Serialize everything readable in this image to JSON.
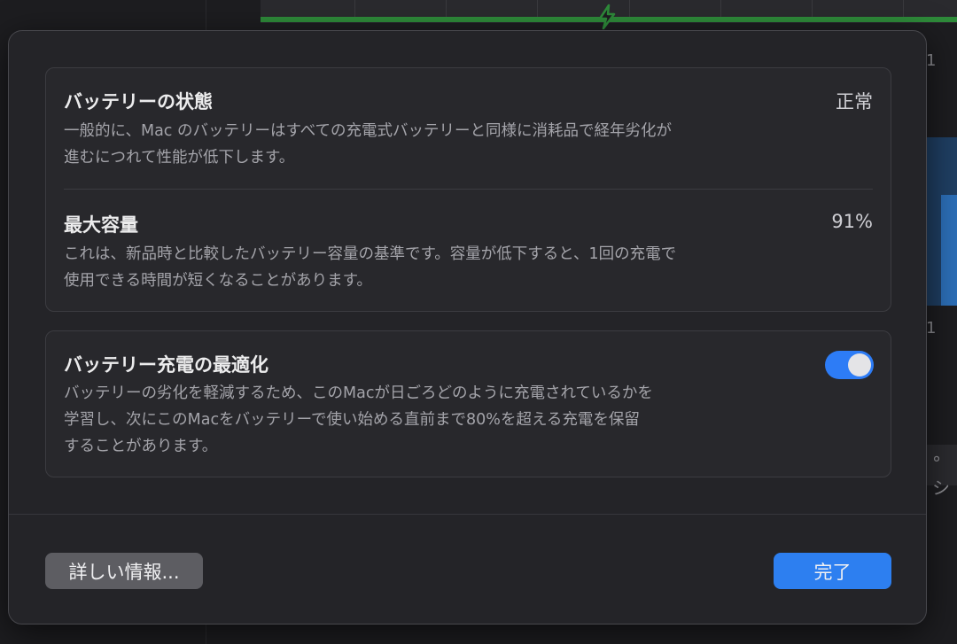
{
  "background": {
    "side_marks": [
      "1",
      "1"
    ],
    "right_pill_text": "°シ"
  },
  "health": {
    "title": "バッテリーの状態",
    "value": "正常",
    "description_line1": "一般的に、Mac のバッテリーはすべての充電式バッテリーと同様に消耗品で経年劣化が",
    "description_line2": "進むにつれて性能が低下します。"
  },
  "capacity": {
    "title": "最大容量",
    "value": "91%",
    "description_line1": "これは、新品時と比較したバッテリー容量の基準です。容量が低下すると、1回の充電で",
    "description_line2": "使用できる時間が短くなることがあります。"
  },
  "optimized": {
    "title": "バッテリー充電の最適化",
    "toggle_on": true,
    "description_line1": "バッテリーの劣化を軽減するため、このMacが日ごろどのように充電されているかを",
    "description_line2": "学習し、次にこのMacをバッテリーで使い始める直前まで80%を超える充電を保留",
    "description_line3": "することがあります。"
  },
  "footer": {
    "more_info_label": "詳しい情報...",
    "done_label": "完了"
  },
  "colors": {
    "accent": "#2d7ff0",
    "toggle_on": "#2d7cf6",
    "chart_green": "#2e8b3a"
  }
}
